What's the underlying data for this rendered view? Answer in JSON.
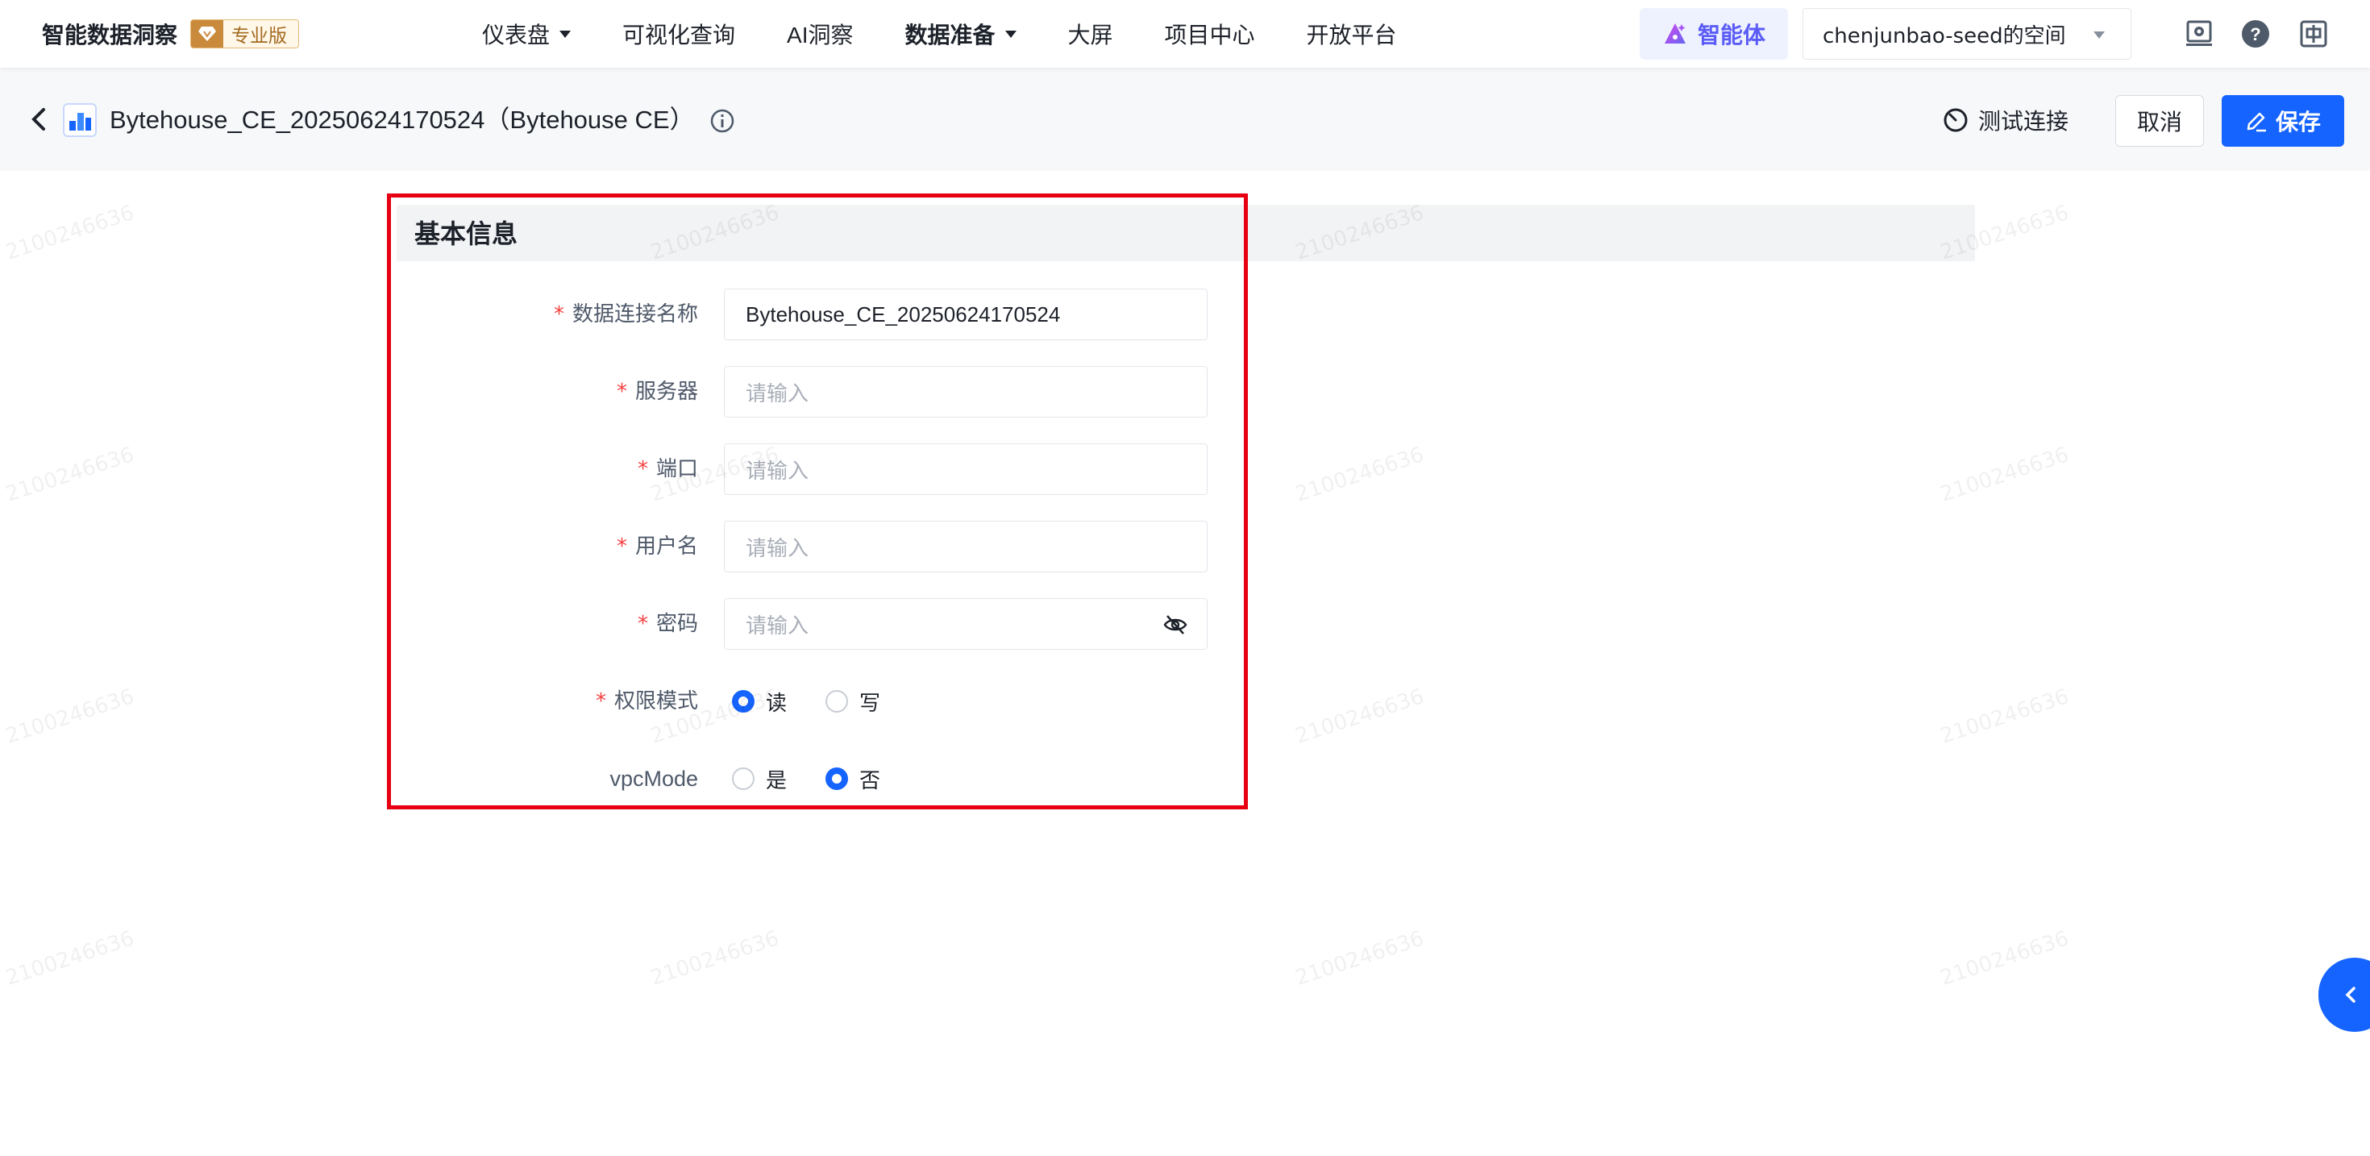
{
  "topnav": {
    "brand": "智能数据洞察",
    "edition_badge": "专业版",
    "menu": [
      {
        "label": "仪表盘",
        "has_caret": true
      },
      {
        "label": "可视化查询",
        "has_caret": false
      },
      {
        "label": "AI洞察",
        "has_caret": false
      },
      {
        "label": "数据准备",
        "has_caret": true
      },
      {
        "label": "大屏",
        "has_caret": false
      },
      {
        "label": "项目中心",
        "has_caret": false
      },
      {
        "label": "开放平台",
        "has_caret": false
      }
    ],
    "agent_label": "智能体",
    "space_selector": "chenjunbao-seed的空间",
    "icons": [
      "task-center-icon",
      "help-icon",
      "language-switch-icon"
    ]
  },
  "header": {
    "title": "Bytehouse_CE_20250624170524（Bytehouse CE）",
    "test_connection": "测试连接",
    "cancel": "取消",
    "save": "保存"
  },
  "form": {
    "section_title": "基本信息",
    "fields": {
      "connection_name": {
        "label": "数据连接名称",
        "required": true,
        "value": "Bytehouse_CE_20250624170524"
      },
      "server": {
        "label": "服务器",
        "required": true,
        "placeholder": "请输入"
      },
      "port": {
        "label": "端口",
        "required": true,
        "placeholder": "请输入"
      },
      "username": {
        "label": "用户名",
        "required": true,
        "placeholder": "请输入"
      },
      "password": {
        "label": "密码",
        "required": true,
        "placeholder": "请输入"
      },
      "permission_mode": {
        "label": "权限模式",
        "required": true,
        "options": [
          "读",
          "写"
        ],
        "selected": "读"
      },
      "vpc_mode": {
        "label": "vpcMode",
        "required": false,
        "options": [
          "是",
          "否"
        ],
        "selected": "否"
      }
    }
  },
  "watermark": "2100246636",
  "colors": {
    "primary": "#1664ff",
    "required": "#f53f3f",
    "highlight": "#e60012",
    "agent": "#5b5cf6"
  }
}
